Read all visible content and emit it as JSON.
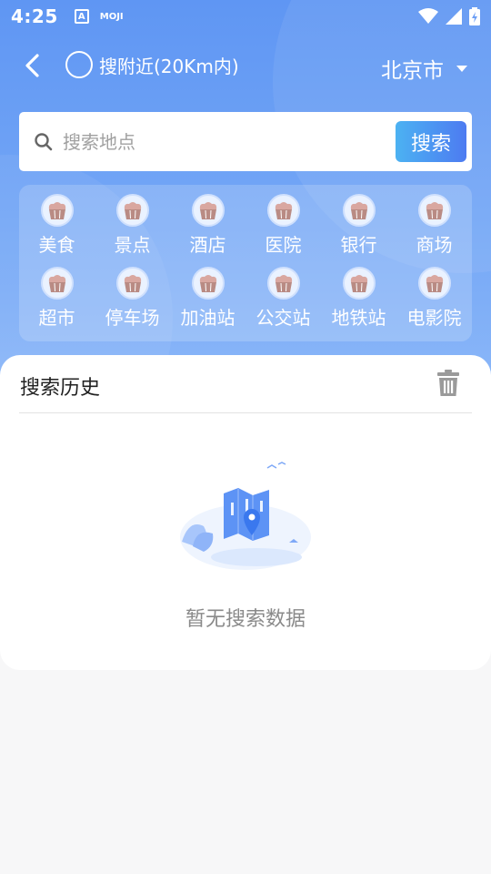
{
  "status_bar": {
    "time": "4:25",
    "app_icon_letter": "A",
    "moji": "MOJI",
    "icons": [
      "wifi-icon",
      "signal-icon",
      "battery-icon"
    ]
  },
  "nav": {
    "back_icon": "back-arrow-icon",
    "nearby_label": "搜附近(20Km内)",
    "city": "北京市"
  },
  "search": {
    "placeholder": "搜索地点",
    "value": "",
    "button_label": "搜索"
  },
  "categories": [
    {
      "label": "美食",
      "icon": "cupcake-icon"
    },
    {
      "label": "景点",
      "icon": "cupcake-icon"
    },
    {
      "label": "酒店",
      "icon": "cupcake-icon"
    },
    {
      "label": "医院",
      "icon": "cupcake-icon"
    },
    {
      "label": "银行",
      "icon": "cupcake-icon"
    },
    {
      "label": "商场",
      "icon": "cupcake-icon"
    },
    {
      "label": "超市",
      "icon": "cupcake-icon"
    },
    {
      "label": "停车场",
      "icon": "cupcake-icon"
    },
    {
      "label": "加油站",
      "icon": "cupcake-icon"
    },
    {
      "label": "公交站",
      "icon": "cupcake-icon"
    },
    {
      "label": "地铁站",
      "icon": "cupcake-icon"
    },
    {
      "label": "电影院",
      "icon": "cupcake-icon"
    }
  ],
  "history": {
    "title": "搜索历史",
    "clear_icon": "trash-icon",
    "empty_text": "暂无搜索数据"
  },
  "colors": {
    "header_top": "#5f96f3",
    "header_bottom": "#8bb7f8",
    "button_start": "#4cb2f2",
    "button_end": "#4d7bf1"
  }
}
